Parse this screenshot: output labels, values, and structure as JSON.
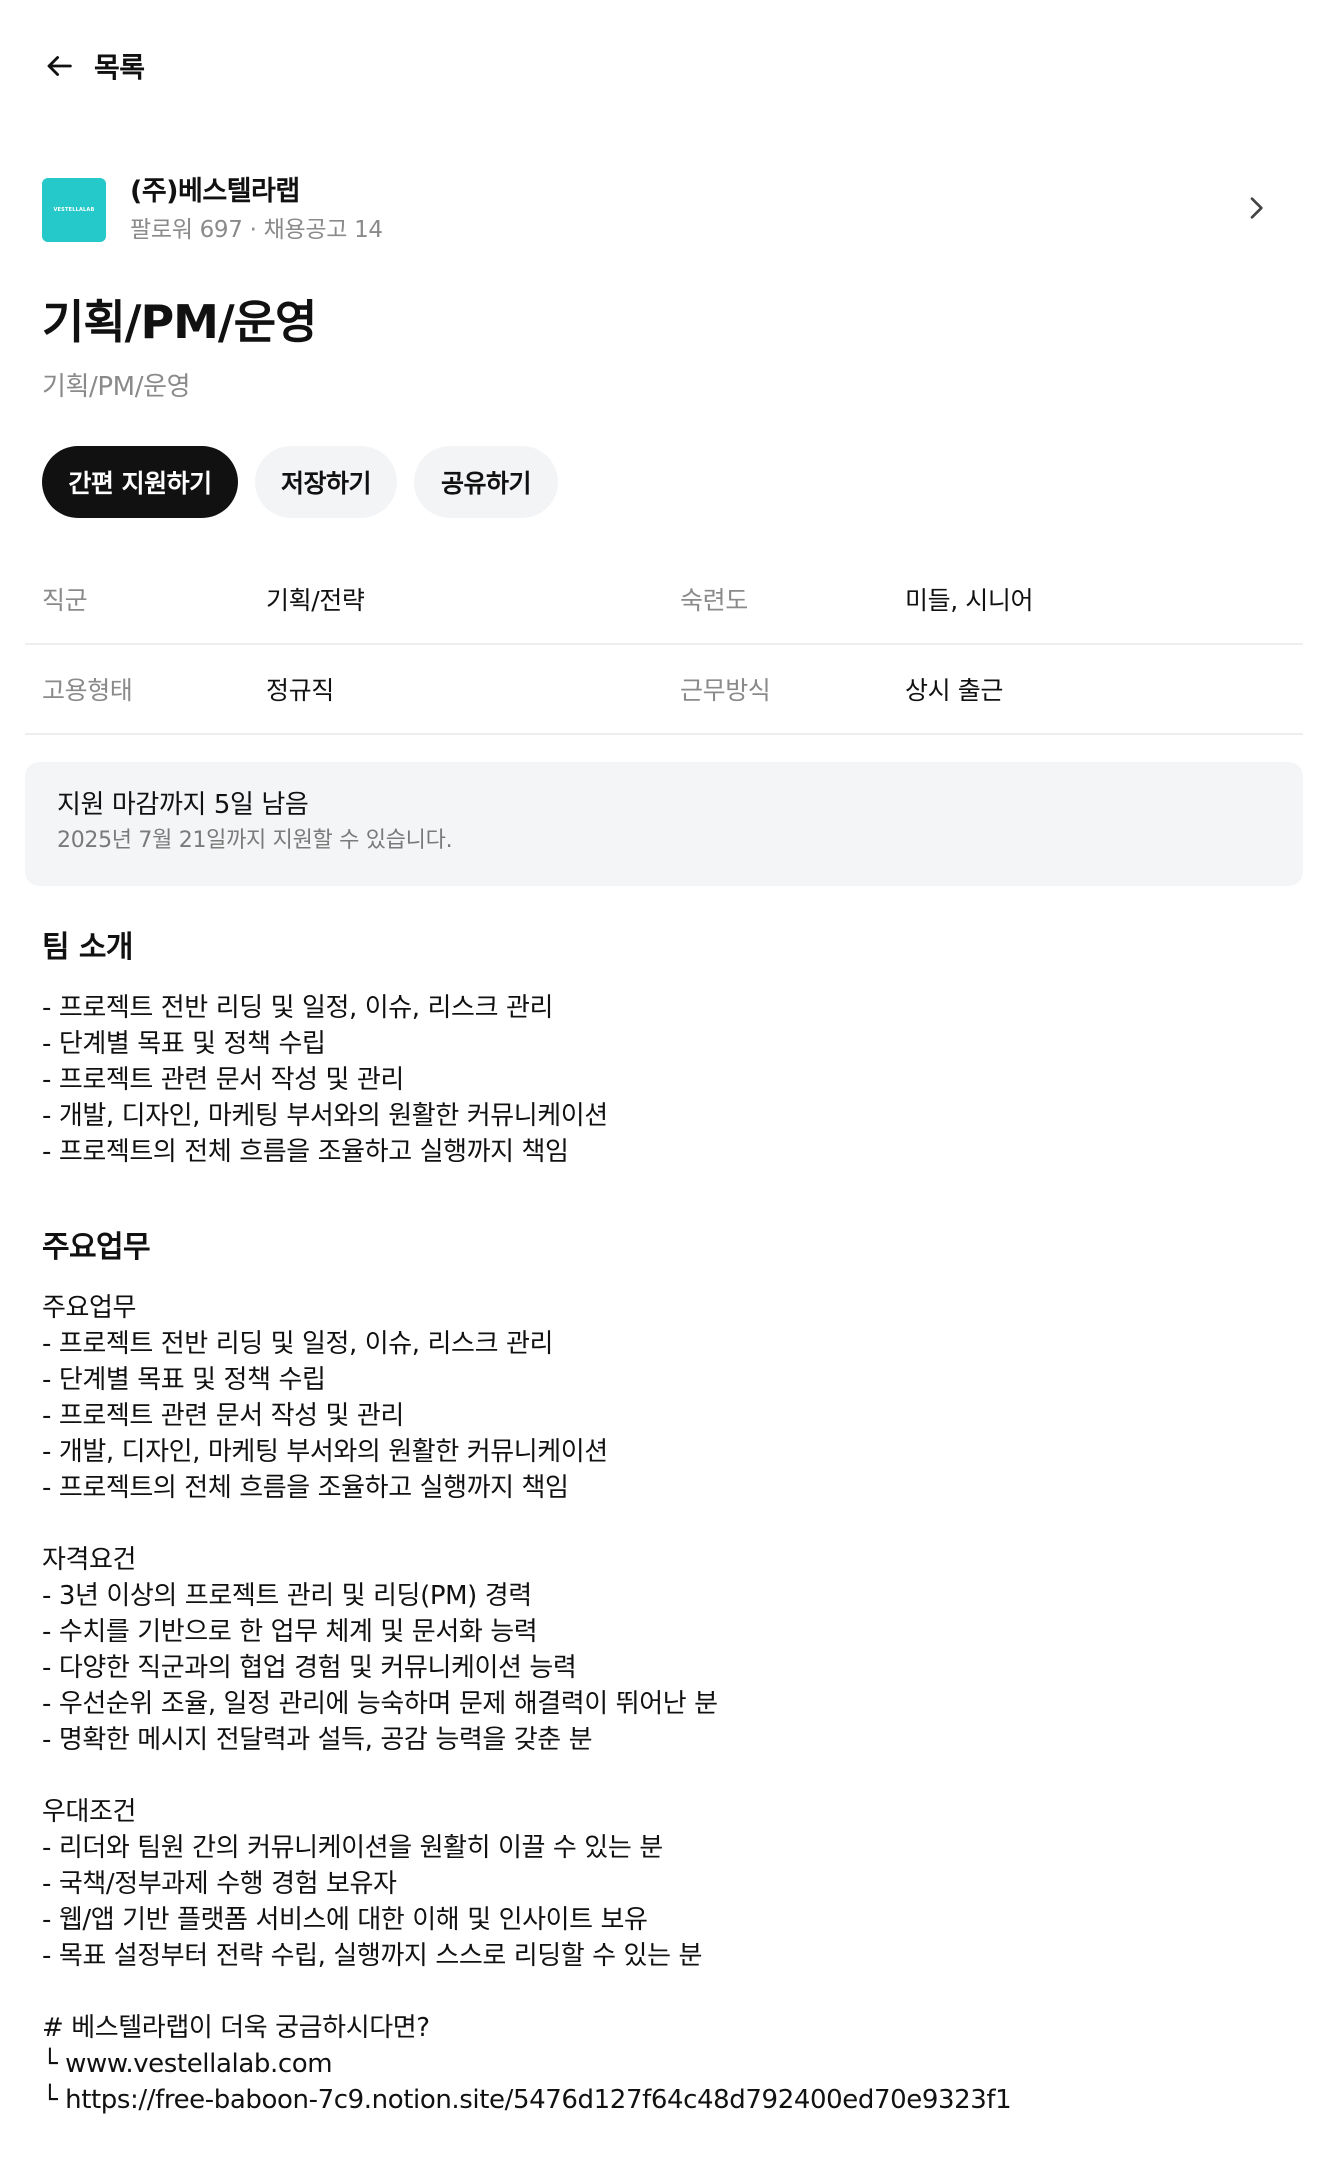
{
  "nav": {
    "back_label": "목록"
  },
  "company": {
    "logo_text": "VESTELLALAB",
    "name": "(주)베스텔라랩",
    "stats": "팔로워 697 · 채용공고 14",
    "brand_color": "#26c9c9"
  },
  "job": {
    "title": "기획/PM/운영",
    "subtitle": "기획/PM/운영"
  },
  "actions": {
    "apply_label": "간편 지원하기",
    "save_label": "저장하기",
    "share_label": "공유하기"
  },
  "meta": [
    {
      "label1": "직군",
      "value1": "기획/전략",
      "label2": "숙련도",
      "value2": "미들, 시니어"
    },
    {
      "label1": "고용형태",
      "value1": "정규직",
      "label2": "근무방식",
      "value2": "상시 출근"
    }
  ],
  "deadline": {
    "title": "지원 마감까지 5일 남음",
    "subtitle": "2025년 7월 21일까지 지원할 수 있습니다."
  },
  "team": {
    "title": "팀 소개",
    "lines": [
      "- 프로젝트 전반 리딩 및 일정, 이슈, 리스크 관리",
      "- 단계별 목표 및 정책 수립",
      "- 프로젝트 관련 문서 작성 및 관리",
      "- 개발, 디자인, 마케팅 부서와의 원활한 커뮤니케이션",
      "- 프로젝트의 전체 흐름을 조율하고 실행까지 책임"
    ]
  },
  "duties": {
    "title": "주요업무",
    "blocks": [
      [
        "주요업무",
        "- 프로젝트 전반 리딩 및 일정, 이슈, 리스크 관리",
        "- 단계별 목표 및 정책 수립",
        "- 프로젝트 관련 문서 작성 및 관리",
        "- 개발, 디자인, 마케팅 부서와의 원활한 커뮤니케이션",
        "- 프로젝트의 전체 흐름을 조율하고 실행까지 책임"
      ],
      [
        "자격요건",
        "- 3년 이상의 프로젝트 관리 및 리딩(PM) 경력",
        "- 수치를 기반으로 한 업무 체계 및 문서화 능력",
        "- 다양한 직군과의 협업 경험 및 커뮤니케이션 능력",
        "- 우선순위 조율, 일정 관리에 능숙하며 문제 해결력이 뛰어난 분",
        "- 명확한 메시지 전달력과 설득, 공감 능력을 갖춘 분"
      ],
      [
        "우대조건",
        "- 리더와 팀원 간의 커뮤니케이션을 원활히 이끌 수 있는 분",
        "- 국책/정부과제 수행 경험 보유자",
        "- 웹/앱 기반 플랫폼 서비스에 대한 이해 및 인사이트 보유",
        "- 목표 설정부터 전략 수립, 실행까지 스스로 리딩할 수 있는 분"
      ],
      [
        "# 베스텔라랩이 더욱 궁금하시다면?",
        "└ www.vestellalab.com",
        "└ https://free-baboon-7c9.notion.site/5476d127f64c48d792400ed70e9323f1"
      ]
    ]
  }
}
